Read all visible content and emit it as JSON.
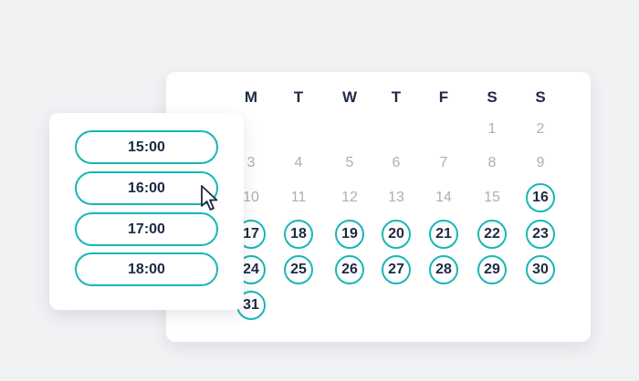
{
  "calendar": {
    "weekdays": [
      "M",
      "T",
      "W",
      "T",
      "F",
      "S",
      "S"
    ],
    "days": [
      {
        "day": "1",
        "available": false
      },
      {
        "day": "2",
        "available": false
      },
      {
        "day": "3",
        "available": false
      },
      {
        "day": "4",
        "available": false
      },
      {
        "day": "5",
        "available": false
      },
      {
        "day": "6",
        "available": false
      },
      {
        "day": "7",
        "available": false
      },
      {
        "day": "8",
        "available": false
      },
      {
        "day": "9",
        "available": false
      },
      {
        "day": "10",
        "available": false
      },
      {
        "day": "11",
        "available": false
      },
      {
        "day": "12",
        "available": false
      },
      {
        "day": "13",
        "available": false
      },
      {
        "day": "14",
        "available": false
      },
      {
        "day": "15",
        "available": false
      },
      {
        "day": "16",
        "available": true
      },
      {
        "day": "17",
        "available": true
      },
      {
        "day": "18",
        "available": true
      },
      {
        "day": "19",
        "available": true
      },
      {
        "day": "20",
        "available": true
      },
      {
        "day": "21",
        "available": true
      },
      {
        "day": "22",
        "available": true
      },
      {
        "day": "23",
        "available": true
      },
      {
        "day": "24",
        "available": true
      },
      {
        "day": "25",
        "available": true
      },
      {
        "day": "26",
        "available": true
      },
      {
        "day": "27",
        "available": true
      },
      {
        "day": "28",
        "available": true
      },
      {
        "day": "29",
        "available": true
      },
      {
        "day": "30",
        "available": true
      },
      {
        "day": "31",
        "available": true
      }
    ]
  },
  "time_slots": {
    "items": [
      "15:00",
      "16:00",
      "17:00",
      "18:00"
    ]
  },
  "colors": {
    "accent": "#17b7b7",
    "text": "#1d2a44",
    "muted_text": "#aab0b9",
    "background": "#f1f2f4",
    "card": "#ffffff"
  },
  "icons": {
    "cursor": "mouse-pointer-icon"
  }
}
